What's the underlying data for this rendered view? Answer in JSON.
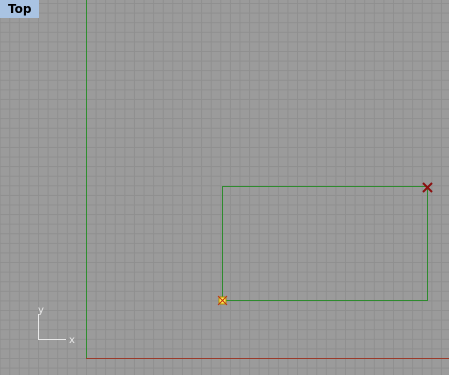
{
  "viewport": {
    "title": "Top",
    "axis_icon": {
      "x_label": "x",
      "y_label": "y"
    }
  },
  "colors": {
    "background": "#9b9b9b",
    "grid_line": "#8f8f8f",
    "y_axis": "#2f8f2f",
    "x_axis": "#9a3a2a",
    "rectangle": "#2e8b2e",
    "point_start": "#ffee55",
    "point_end": "#8b1010"
  }
}
